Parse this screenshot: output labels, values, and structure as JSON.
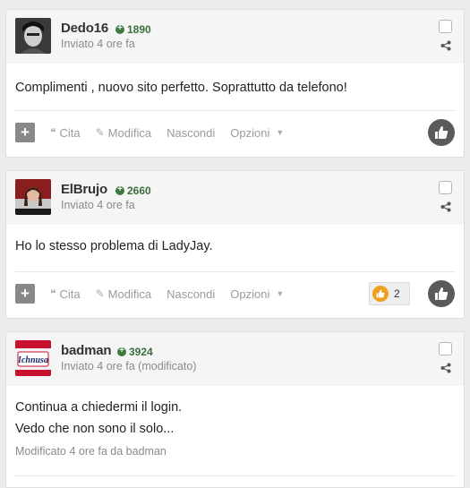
{
  "posts": [
    {
      "username": "Dedo16",
      "reputation": "1890",
      "posted": "Inviato 4 ore fa",
      "body": [
        "Complimenti , nuovo sito perfetto. Soprattutto da telefono!"
      ],
      "edited_note": "",
      "reaction_count": ""
    },
    {
      "username": "ElBrujo",
      "reputation": "2660",
      "posted": "Inviato 4 ore fa",
      "body": [
        "Ho lo stesso problema di LadyJay."
      ],
      "edited_note": "",
      "reaction_count": "2"
    },
    {
      "username": "badman",
      "reputation": "3924",
      "posted": "Inviato 4 ore fa (modificato)",
      "body": [
        "Continua a chiedermi il login.",
        "Vedo che non sono il solo..."
      ],
      "edited_note": "Modificato 4 ore fa da badman",
      "reaction_count": ""
    }
  ],
  "controls": {
    "quote": "Cita",
    "edit": "Modifica",
    "hide": "Nascondi",
    "options": "Opzioni"
  },
  "avatar3_text": "Ichnusa",
  "icons": {
    "plus": "plus-icon",
    "quote": "quote-icon",
    "edit": "pencil-icon",
    "caret": "caret-down-icon",
    "share": "share-icon",
    "like": "thumbs-up-icon"
  },
  "colors": {
    "rep_green": "#3b7a3b",
    "header_bg": "#f5f5f5",
    "like_bg": "#5a5a5a"
  }
}
